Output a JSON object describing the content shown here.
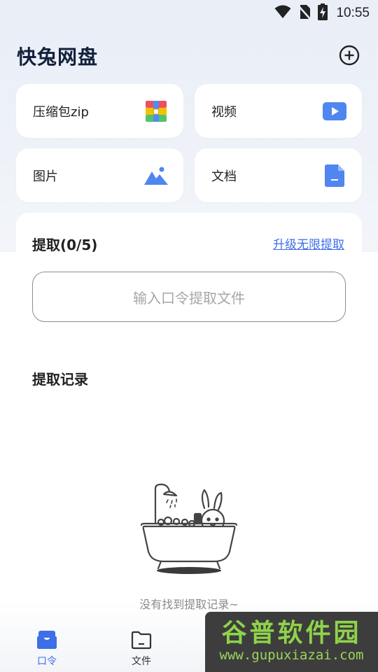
{
  "status_bar": {
    "time": "10:55",
    "icons": [
      "wifi-icon",
      "no-sim-icon",
      "battery-charging-icon"
    ]
  },
  "app": {
    "title": "快兔网盘",
    "add_icon": "plus-circle-icon"
  },
  "categories": [
    {
      "label": "压缩包zip",
      "icon": "zip-archive-icon"
    },
    {
      "label": "视频",
      "icon": "video-play-icon"
    },
    {
      "label": "图片",
      "icon": "image-mountain-icon"
    },
    {
      "label": "文档",
      "icon": "document-icon"
    }
  ],
  "extract": {
    "title": "提取(0/5)",
    "upgrade_link": "升级无限提取",
    "input_placeholder": "输入口令提取文件"
  },
  "records": {
    "title": "提取记录",
    "empty_text": "没有找到提取记录~",
    "illustration": "rabbit-in-bathtub-illustration"
  },
  "tabbar": {
    "tabs": [
      {
        "label": "口令",
        "icon": "inbox-icon",
        "active": true
      },
      {
        "label": "文件",
        "icon": "folder-icon",
        "active": false
      }
    ]
  },
  "watermark": {
    "title": "谷普软件园",
    "url": "www.gupuxiazai.com"
  },
  "colors": {
    "accent": "#3e6ee8",
    "title": "#13203d",
    "background": "#eef2f8"
  }
}
